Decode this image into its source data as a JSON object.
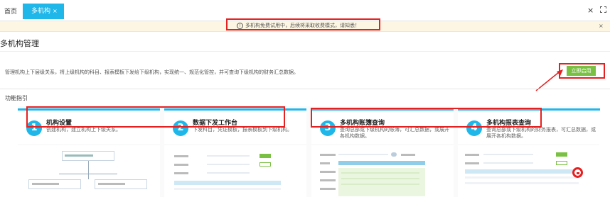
{
  "tabs": {
    "home": "首页",
    "active": "多机构",
    "active_close": "×"
  },
  "toolbar": {
    "close": "×"
  },
  "notice": {
    "icon": "!",
    "text": "多机构免费试用中，后续将采取收费模式，请知悉！",
    "close": "×"
  },
  "page": {
    "title": "多机构管理",
    "description": "管理机构上下层级关系，将上级机构的科目、报表模板下发给下级机构，实现统一、规范化管控，并可查询下级机构的财务汇总数据。",
    "enable_button": "立即启用",
    "guide_title": "功能指引"
  },
  "cards": [
    {
      "number": "1",
      "title": "机构设置",
      "desc": "创建机构，建立机构上下级关系。"
    },
    {
      "number": "2",
      "title": "数据下发工作台",
      "desc": "下发科目，凭证模板，报表模板到下级机构。"
    },
    {
      "number": "3",
      "title": "多机构账簿查询",
      "desc": "查询总部或下级机构的账簿，可汇总数据，或展开各机构数据。"
    },
    {
      "number": "4",
      "title": "多机构报表查询",
      "desc": "查询总部或下级机构的财务报表，可汇总数据，或展开各机构数据。"
    }
  ],
  "colors": {
    "accent": "#1fb6e9",
    "green": "#7ac143",
    "annotation_red": "#e62020",
    "notice_bg": "#fdf6e3"
  }
}
